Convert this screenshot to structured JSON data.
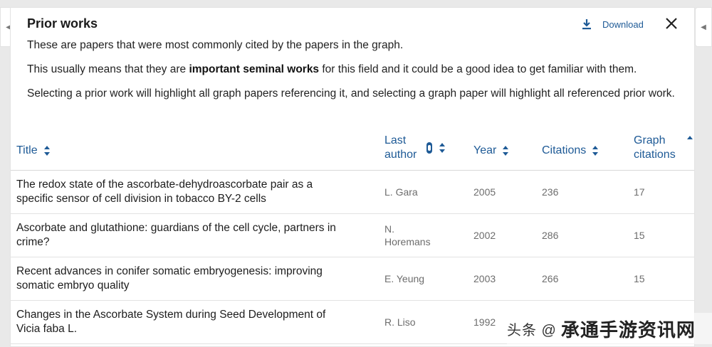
{
  "panel": {
    "title": "Prior works",
    "download_label": "Download",
    "paragraph1": "These are papers that were most commonly cited by the papers in the graph.",
    "paragraph2_before": "This usually means that they are ",
    "paragraph2_bold": "important seminal works",
    "paragraph2_after": " for this field and it could be a good idea to get familiar with them.",
    "paragraph3": "Selecting a prior work will highlight all graph papers referencing it, and selecting a graph paper will highlight all referenced prior work."
  },
  "table": {
    "headers": {
      "title": "Title",
      "last_author": "Last author",
      "year": "Year",
      "citations": "Citations",
      "graph_citations": "Graph citations"
    },
    "rows": [
      {
        "title": "The redox state of the ascorbate-dehydroascorbate pair as a specific sensor of cell division in tobacco BY-2 cells",
        "author": "L. Gara",
        "year": "2005",
        "citations": "236",
        "graph_citations": "17"
      },
      {
        "title": "Ascorbate and glutathione: guardians of the cell cycle, partners in crime?",
        "author": "N. Horemans",
        "year": "2002",
        "citations": "286",
        "graph_citations": "15"
      },
      {
        "title": "Recent advances in conifer somatic embryogenesis: improving somatic embryo quality",
        "author": "E. Yeung",
        "year": "2003",
        "citations": "266",
        "graph_citations": "15"
      },
      {
        "title": "Changes in the Ascorbate System during Seed Development of Vicia faba L.",
        "author": "R. Liso",
        "year": "1992",
        "citations": "",
        "graph_citations": ""
      }
    ]
  },
  "watermark": {
    "small": "头条 @",
    "large": "承通手游资讯网"
  },
  "colors": {
    "accent": "#1e5a96",
    "text": "#222222",
    "muted": "#6d6d6d"
  }
}
